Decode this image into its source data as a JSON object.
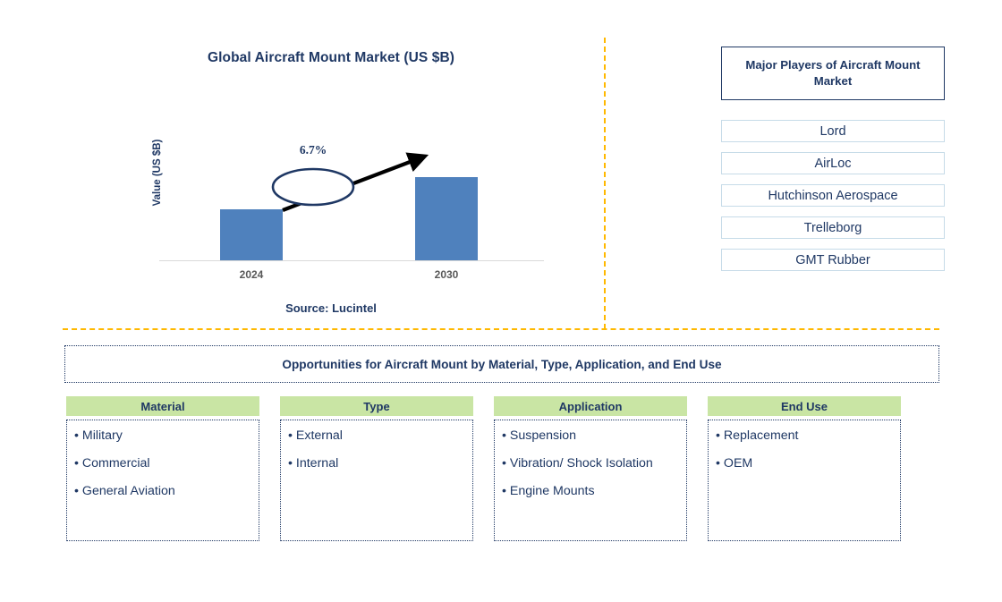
{
  "chart_panel": {
    "title": "Global Aircraft Mount Market (US $B)",
    "y_axis_label": "Value (US $B)",
    "cagr_label": "6.7%",
    "source": "Source: Lucintel"
  },
  "chart_data": {
    "type": "bar",
    "title": "Global Aircraft Mount Market (US $B)",
    "categories": [
      "2024",
      "2030"
    ],
    "values": [
      0.62,
      1.0
    ],
    "series": [
      {
        "name": "Value (US $B)",
        "values": [
          0.62,
          1.0
        ]
      }
    ],
    "xlabel": "",
    "ylabel": "Value (US $B)",
    "ylim": [
      0,
      1.2
    ],
    "grid": false,
    "legend": "none",
    "annotations": [
      {
        "text": "6.7%",
        "type": "cagr-callout",
        "from": "2024",
        "to": "2030"
      }
    ],
    "bar_color": "#4f81bd",
    "source": "Source: Lucintel"
  },
  "players": {
    "header": "Major Players of Aircraft Mount Market",
    "items": [
      {
        "label": "Lord"
      },
      {
        "label": "AirLoc"
      },
      {
        "label": "Hutchinson Aerospace"
      },
      {
        "label": "Trelleborg"
      },
      {
        "label": "GMT Rubber"
      }
    ]
  },
  "opportunities": {
    "banner": "Opportunities for Aircraft Mount by Material, Type, Application, and End Use",
    "columns": [
      {
        "header": "Material",
        "items": [
          "• Military",
          "• Commercial",
          "• General Aviation"
        ]
      },
      {
        "header": "Type",
        "items": [
          "• External",
          "• Internal"
        ]
      },
      {
        "header": "Application",
        "items": [
          "• Suspension",
          "• Vibration/ Shock Isolation",
          "• Engine Mounts"
        ]
      },
      {
        "header": "End Use",
        "items": [
          "• Replacement",
          "• OEM"
        ]
      }
    ]
  },
  "colors": {
    "navy": "#1f3864",
    "bar_blue": "#4f81bd",
    "divider_orange": "#ffb800",
    "header_green": "#c9e5a4",
    "player_border": "#c6dbe8"
  }
}
